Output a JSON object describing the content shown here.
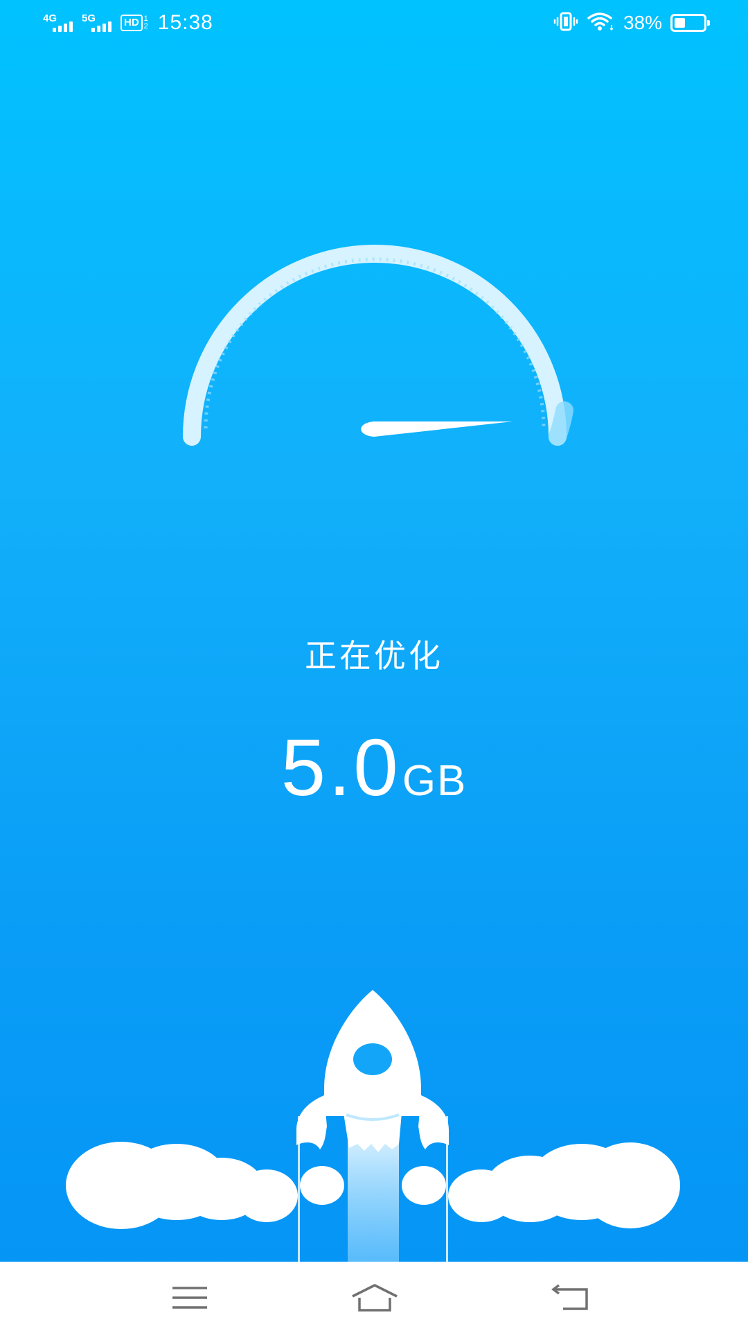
{
  "status_bar": {
    "network1": "4G",
    "network2": "5G",
    "hd_label": "HD",
    "hd_sim": "1\n2",
    "time": "15:38",
    "battery_percent": "38%",
    "battery_level": 0.38,
    "icons": [
      "vibrate-icon",
      "wifi-icon",
      "battery-icon"
    ]
  },
  "gauge": {
    "needle_level": 0.97
  },
  "main": {
    "status_text": "正在优化",
    "size_value": "5.0",
    "size_unit": "GB"
  },
  "nav_bar": {
    "buttons": [
      "menu-icon",
      "home-icon",
      "back-icon"
    ]
  },
  "colors": {
    "background_top": "#00c2ff",
    "background_bottom": "#0494f5",
    "foreground": "#ffffff",
    "nav_bar": "#ffffff"
  }
}
